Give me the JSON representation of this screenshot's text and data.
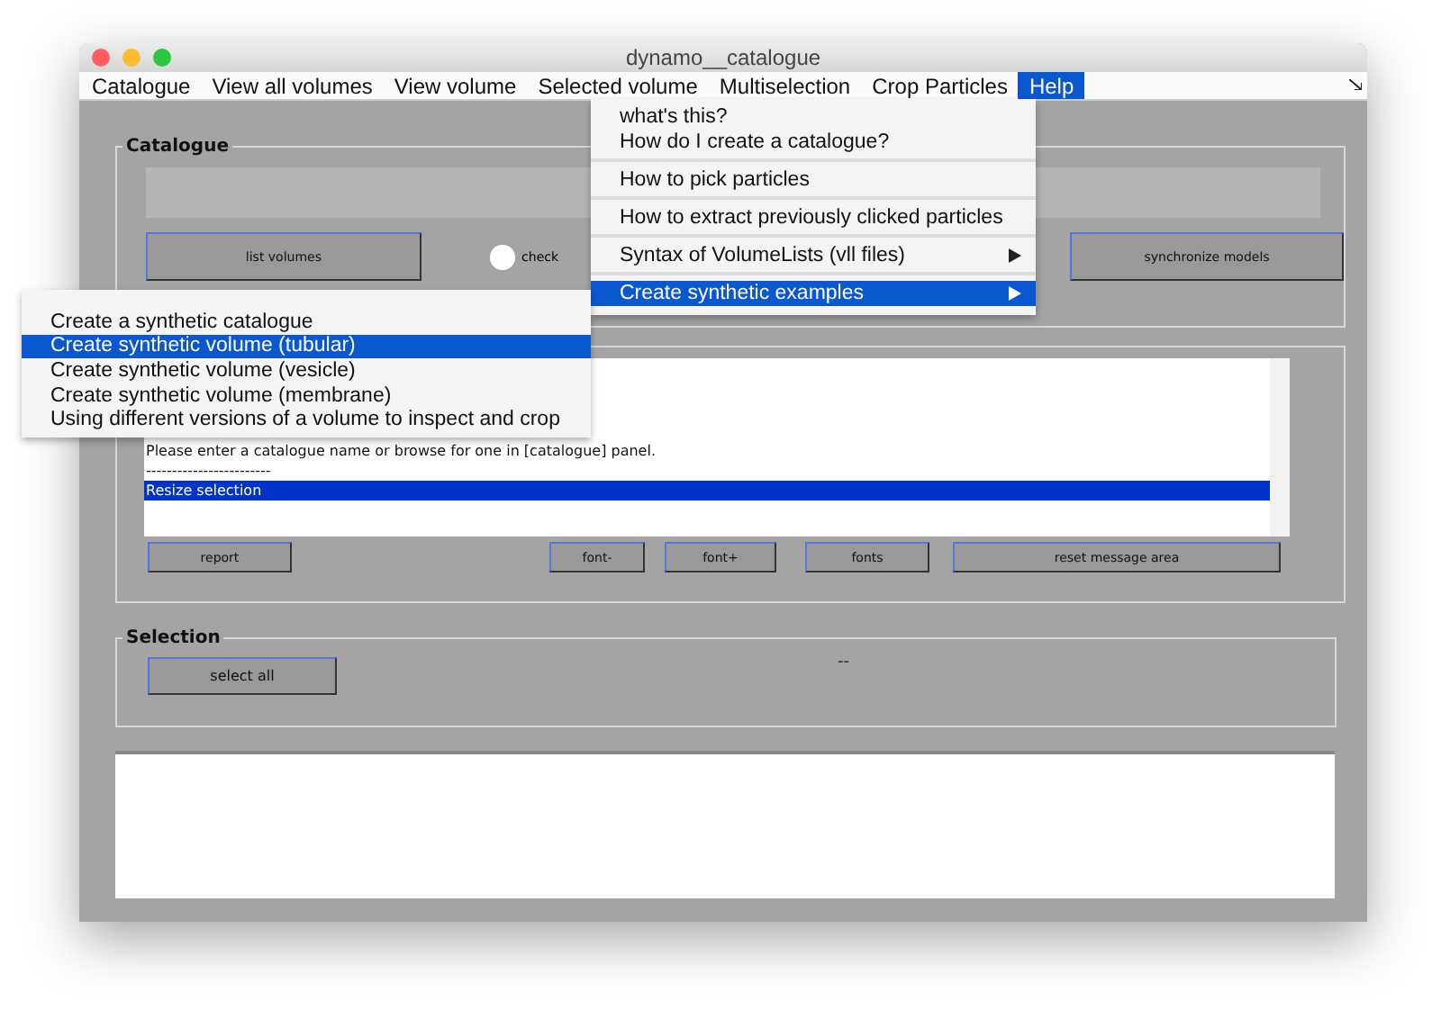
{
  "window": {
    "title": "dynamo__catalogue"
  },
  "menubar": [
    {
      "label": "Catalogue",
      "selected": false
    },
    {
      "label": "View all volumes",
      "selected": false
    },
    {
      "label": "View volume",
      "selected": false
    },
    {
      "label": "Selected volume",
      "selected": false
    },
    {
      "label": "Multiselection",
      "selected": false
    },
    {
      "label": "Crop Particles",
      "selected": false
    },
    {
      "label": "Help",
      "selected": true
    }
  ],
  "help_menu": {
    "groups": [
      [
        {
          "label": "what's this?",
          "kind": "item",
          "selected": false
        },
        {
          "label": "How do I create a catalogue?",
          "kind": "item",
          "selected": false
        }
      ],
      [
        {
          "label": "How to pick particles",
          "kind": "item",
          "selected": false
        }
      ],
      [
        {
          "label": "How to extract previously clicked particles",
          "kind": "item",
          "selected": false
        }
      ],
      [
        {
          "label": "Syntax of VolumeLists (vll files)",
          "kind": "submenu",
          "selected": false
        }
      ],
      [
        {
          "label": "Create synthetic examples",
          "kind": "submenu",
          "selected": true
        }
      ]
    ]
  },
  "submenu": [
    {
      "label": "Create a synthetic catalogue",
      "selected": false
    },
    {
      "label": "Create synthetic volume (tubular)",
      "selected": true
    },
    {
      "label": "Create synthetic volume (vesicle)",
      "selected": false
    },
    {
      "label": "Create synthetic volume (membrane)",
      "selected": false
    },
    {
      "label": "Using different versions of a volume to inspect and crop",
      "selected": false
    }
  ],
  "catalogue_panel": {
    "title": "Catalogue",
    "list_button": "list volumes",
    "check": {
      "label": "check",
      "checked": false
    },
    "sync_button": "synchronize models"
  },
  "message_panel": {
    "lines": [
      {
        "text": "Please enter a catalogue name or browse for one in [catalogue] panel.",
        "selected": false
      },
      {
        "text": "------------------------",
        "selected": false
      },
      {
        "text": "Resize selection",
        "selected": true
      }
    ],
    "buttons": [
      "report",
      "font-",
      "font+",
      "fonts",
      "reset message area"
    ]
  },
  "selection_panel": {
    "title": "Selection",
    "button": "select all",
    "status": "--"
  }
}
